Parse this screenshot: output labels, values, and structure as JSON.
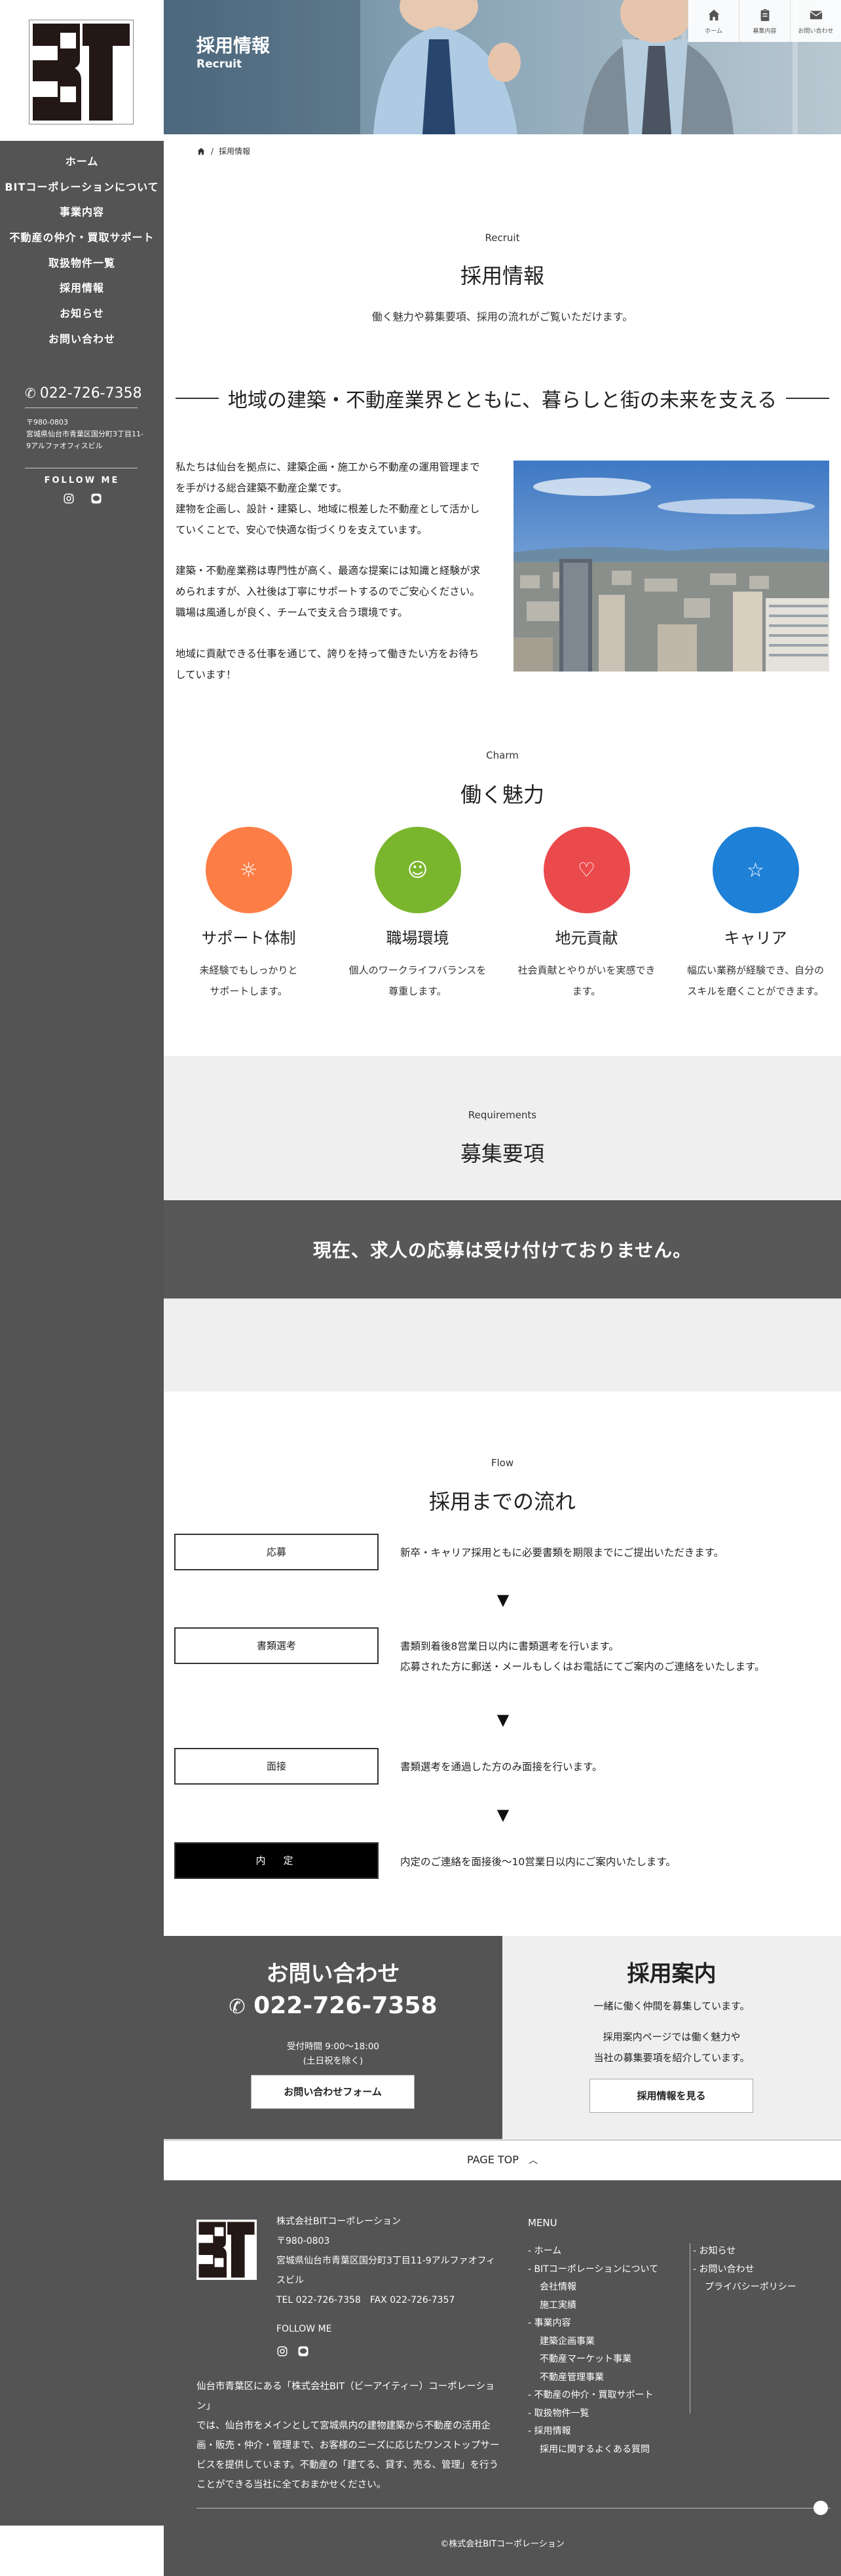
{
  "sidebar": {
    "nav": [
      "ホーム",
      "BITコーポレーションについて",
      "事業内容",
      "不動産の仲介・買取サポート",
      "取扱物件一覧",
      "採用情報",
      "お知らせ",
      "お問い合わせ"
    ],
    "tel": "022-726-7358",
    "zip": "〒980-0803",
    "address": "宮城県仙台市青葉区国分町3丁目11-9アルファオフィスビル",
    "follow": "FOLLOW ME",
    "sns": [
      "instagram-icon",
      "line-icon"
    ]
  },
  "hero": {
    "title": "採用情報",
    "subtitle": "Recruit",
    "quick_nav": [
      "ホーム",
      "募集内容",
      "お問い合わせ"
    ]
  },
  "breadcrumb": {
    "current": "採用情報"
  },
  "recruit": {
    "en": "Recruit",
    "title": "採用情報",
    "lead": "働く魅力や募集要項、採用の流れがご覧いただけます。",
    "catch": "地域の建築・不動産業界とともに、暮らしと街の未来を支える",
    "paragraphs": [
      [
        "私たちは仙台を拠点に、建築企画・施工から不動産の運用管理まで",
        "を手がける総合建築不動産企業です。",
        "建物を企画し、設計・建築し、地域に根差した不動産として活かし",
        "ていくことで、安心で快適な街づくりを支えています。"
      ],
      [
        "建築・不動産業務は専門性が高く、最適な提案には知識と経験が求",
        "められますが、入社後は丁寧にサポートするのでご安心ください。",
        "職場は風通しが良く、チームで支え合う環境です。"
      ],
      [
        "地域に貢献できる仕事を通じて、誇りを持って働きたい方をお待ち",
        "しています！"
      ]
    ]
  },
  "charm": {
    "en": "Charm",
    "title": "働く魅力",
    "items": [
      {
        "title": "サポート体制",
        "icon": "lightbulb-icon",
        "color": "#fc7e46",
        "lines": [
          "未経験でもしっかりと",
          "サポートします。"
        ]
      },
      {
        "title": "職場環境",
        "icon": "smile-icon",
        "color": "#79b62d",
        "lines": [
          "個人のワークライフバランスを",
          "尊重します。"
        ]
      },
      {
        "title": "地元貢献",
        "icon": "heart-icon",
        "color": "#eb4a4d",
        "lines": [
          "社会貢献とやりがいを実感でき",
          "ます。"
        ]
      },
      {
        "title": "キャリア",
        "icon": "star-icon",
        "color": "#1e80d6",
        "lines": [
          "幅広い業務が経験でき、自分の",
          "スキルを磨くことができます。"
        ]
      }
    ]
  },
  "requirements": {
    "en": "Requirements",
    "title": "募集要項",
    "notice": "現在、求人の応募は受け付けておりません。"
  },
  "flow": {
    "en": "Flow",
    "title": "採用までの流れ",
    "steps": [
      {
        "label": "応募",
        "lines": [
          "新卒・キャリア採用ともに必要書類を期限までにご提出いただきます。"
        ]
      },
      {
        "label": "書類選考",
        "lines": [
          "書類到着後8営業日以内に書類選考を行います。",
          "応募された方に郵送・メールもしくはお電話にてご案内のご連絡をいたします。"
        ]
      },
      {
        "label": "面接",
        "lines": [
          "書類選考を通過した方のみ面接を行います。"
        ]
      },
      {
        "label": "内　定",
        "lines": [
          "内定のご連絡を面接後〜10営業日以内にご案内いたします。"
        ]
      }
    ],
    "arrow": "▼"
  },
  "cta": {
    "contact": {
      "title": "お問い合わせ",
      "tel": "022-726-7358",
      "hours": "受付時間 9:00〜18:00",
      "holiday": "(土日祝を除く)",
      "button": "お問い合わせフォーム"
    },
    "recruit": {
      "title": "採用案内",
      "lead": "一緒に働く仲間を募集しています。",
      "text1": "採用案内ページでは働く魅力や",
      "text2": "当社の募集要項を紹介しています。",
      "button": "採用情報を見る"
    }
  },
  "pagetop": "PAGE TOP",
  "footer": {
    "company": "株式会社BITコーポレーション",
    "zip": "〒980-0803",
    "address1": "宮城県仙台市青葉区国分町3丁目11-9アルファオフィ",
    "address2": "スビル",
    "tel": "TEL 022-726-7358",
    "fax": "FAX 022-726-7357",
    "follow": "FOLLOW ME",
    "description": [
      "仙台市青葉区にある「株式会社BIT（ビーアイティー）コーポレーション」",
      "では、仙台市をメインとして宮城県内の建物建築から不動産の活用企",
      "画・販売・仲介・管理まで、お客様のニーズに応じたワンストップサー",
      "ビスを提供しています。不動産の「建てる、貸す、売る、管理」を行う",
      "ことができる当社に全ておまかせください。"
    ],
    "menu_title": "MENU",
    "menu_left": [
      {
        "text": "- ホーム",
        "sub": false
      },
      {
        "text": "- BITコーポレーションについて",
        "sub": false
      },
      {
        "text": "会社情報",
        "sub": true
      },
      {
        "text": "施工実績",
        "sub": true
      },
      {
        "text": "- 事業内容",
        "sub": false
      },
      {
        "text": "建築企画事業",
        "sub": true
      },
      {
        "text": "不動産マーケット事業",
        "sub": true
      },
      {
        "text": "不動産管理事業",
        "sub": true
      },
      {
        "text": "- 不動産の仲介・買取サポート",
        "sub": false
      },
      {
        "text": "- 取扱物件一覧",
        "sub": false
      },
      {
        "text": "- 採用情報",
        "sub": false
      },
      {
        "text": "採用に関するよくある質問",
        "sub": true
      }
    ],
    "menu_right": [
      {
        "text": "- お知らせ",
        "sub": false
      },
      {
        "text": "- お問い合わせ",
        "sub": false
      },
      {
        "text": "プライバシーポリシー",
        "sub": true
      }
    ],
    "copyright": "©株式会社BITコーポレーション"
  }
}
